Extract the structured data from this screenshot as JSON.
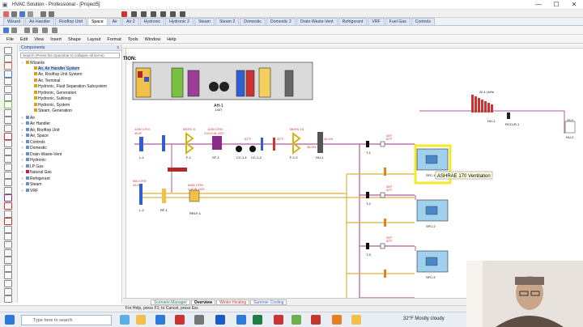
{
  "window": {
    "title": "HVAC Solution - Professional - [Project5]",
    "minimize": "—",
    "maximize": "☐",
    "close": "✕"
  },
  "tabs": [
    "Wizard",
    "Air Handler",
    "Rooftop Unit",
    "Space",
    "Air",
    "Air 2",
    "Hydronic",
    "Hydronic 2",
    "Steam",
    "Steam 2",
    "Domestic",
    "Domestic 2",
    "Drain-Waste-Vent",
    "Refrigerant",
    "VRF",
    "Fuel Gas",
    "Controls"
  ],
  "active_tab": "Space",
  "menu": [
    "File",
    "Edit",
    "View",
    "Insert",
    "Shape",
    "Layout",
    "Format",
    "Tools",
    "Window",
    "Help"
  ],
  "components": {
    "header": "Components",
    "close": "x",
    "search_placeholder": "Search (Press the Spacebar to collapse all items)",
    "tree": [
      {
        "label": "Wizards",
        "level": 0,
        "expander": "−",
        "color": "#d9a21c"
      },
      {
        "label": "Air, Air Handler System",
        "level": 1,
        "color": "#d9a21c",
        "selected": true
      },
      {
        "label": "Air, Rooftop Unit System",
        "level": 1,
        "color": "#d9a21c"
      },
      {
        "label": "Air, Terminal",
        "level": 1,
        "color": "#d9a21c"
      },
      {
        "label": "Hydronic, Fluid Separation Subsystem",
        "level": 1,
        "color": "#d9a21c"
      },
      {
        "label": "Hydronic, Generation",
        "level": 1,
        "color": "#d9a21c"
      },
      {
        "label": "Hydronic, Subloop",
        "level": 1,
        "color": "#d9a21c"
      },
      {
        "label": "Hydronic, System",
        "level": 1,
        "color": "#d9a21c"
      },
      {
        "label": "Steam, Generation",
        "level": 1,
        "color": "#d9a21c"
      },
      {
        "label": "Air",
        "level": 0,
        "expander": "+",
        "color": "#6a8fcf"
      },
      {
        "label": "Air Handler",
        "level": 0,
        "expander": "+",
        "color": "#6a8fcf"
      },
      {
        "label": "Air, Rooftop Unit",
        "level": 0,
        "expander": "+",
        "color": "#6a8fcf"
      },
      {
        "label": "Air, Space",
        "level": 0,
        "expander": "+",
        "color": "#6a8fcf"
      },
      {
        "label": "Controls",
        "level": 0,
        "expander": "+",
        "color": "#6a8fcf"
      },
      {
        "label": "Domestic",
        "level": 0,
        "expander": "+",
        "color": "#6a8fcf"
      },
      {
        "label": "Drain-Waste-Vent",
        "level": 0,
        "expander": "+",
        "color": "#6a8fcf"
      },
      {
        "label": "Hydronic",
        "level": 0,
        "expander": "+",
        "color": "#6a8fcf"
      },
      {
        "label": "LP Gas",
        "level": 0,
        "expander": "+",
        "color": "#6a8fcf"
      },
      {
        "label": "Natural Gas",
        "level": 0,
        "expander": "+",
        "color": "#c2185b"
      },
      {
        "label": "Refrigerant",
        "level": 0,
        "expander": "+",
        "color": "#6a8fcf"
      },
      {
        "label": "Steam",
        "level": 0,
        "expander": "+",
        "color": "#6a8fcf"
      },
      {
        "label": "VRF",
        "level": 0,
        "expander": "+",
        "color": "#6a8fcf"
      }
    ]
  },
  "diagram": {
    "section_label": "TION:",
    "ahu": {
      "label": "AH-1",
      "sub": "1/4/7",
      "parts": [
        "E",
        "E",
        "E",
        "E",
        "E"
      ]
    },
    "supply_components": [
      {
        "tag": "L-1",
        "value": "1250 CFM",
        "value2": "45.8°"
      },
      {
        "tag": "F-1",
        "value": "MERV 8"
      },
      {
        "tag": "SF-1",
        "value": "1250 CFM",
        "value2": "3.0/4.3 IN. H2O"
      },
      {
        "tag": "CC-1-1",
        "value": "62°F"
      },
      {
        "tag": "CC-1-2",
        "value": "52°F"
      },
      {
        "tag": "F-1-2",
        "value": "MERV 15"
      },
      {
        "tag": "HU-1",
        "value": "36.4%"
      }
    ],
    "supply_readout": "46.4%",
    "return_components": [
      {
        "tag": "L-2",
        "value": "960 CFM",
        "value2": "45.8°"
      },
      {
        "tag": "RF-1",
        "value": "RF-1"
      },
      {
        "tag": "RRLF-1",
        "value": "6460 CFM",
        "value2": "2.43 IN. H2O"
      }
    ],
    "terminals": [
      {
        "tag": "T-1",
        "temp": "55°F",
        "temp2": "62°F",
        "unit": "SFC-1"
      },
      {
        "tag": "T-2",
        "temp": "55°F",
        "temp2": "62°F",
        "unit": "SFC-2"
      },
      {
        "tag": "T-3",
        "temp": "55°F",
        "temp2": "62°F",
        "unit": "SFC-3"
      }
    ],
    "humidifier": {
      "tag": "HU-1",
      "value": "20.1 Lb/hr",
      "tag2": "HU-2",
      "tag3": "RCCLR-1",
      "value2": "25.0"
    },
    "tooltip": "ASHRAE 170 Ventilation"
  },
  "sheet_tabs": [
    "Scenario Manager",
    "Overview",
    "Winter Heating",
    "Summer Cooling"
  ],
  "active_sheet": "Overview",
  "status": "For Help, press F1; to Cancel, press Esc",
  "taskbar": {
    "search_placeholder": "Type here to search",
    "weather": "32°F  Mostly cloudy"
  },
  "colors": {
    "accent": "#1d3a6e",
    "supply_duct": "#b05aa0",
    "return_duct": "#e0b23c",
    "highlight": "#f3ea2a"
  }
}
